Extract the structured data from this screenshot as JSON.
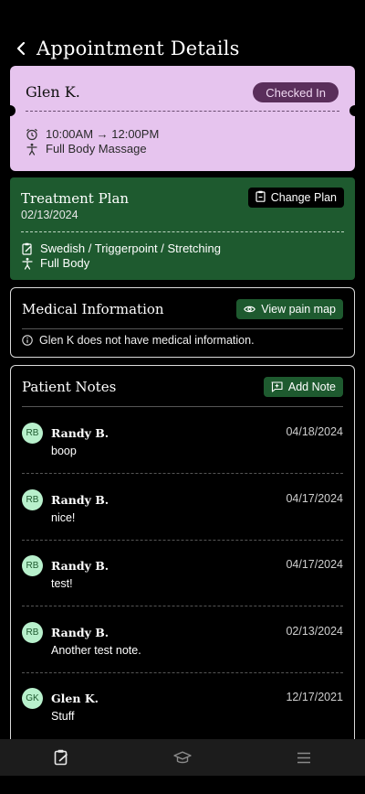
{
  "header": {
    "title": "Appointment Details",
    "back_icon": "chevron-left-icon"
  },
  "appointment": {
    "patient_name": "Glen K.",
    "status": "Checked In",
    "time_range": "10:00AM → 12:00PM",
    "service": "Full Body Massage",
    "bg_color": "#e6c4ee",
    "status_color": "#5a2e5b"
  },
  "treatment_plan": {
    "title": "Treatment Plan",
    "date": "02/13/2024",
    "change_label": "Change Plan",
    "techniques": "Swedish / Triggerpoint / Stretching",
    "area": "Full Body",
    "bg_color": "#1e5a2f"
  },
  "medical": {
    "title": "Medical Information",
    "pain_map_label": "View pain map",
    "info_text": "Glen K does not have medical information."
  },
  "notes": {
    "title": "Patient Notes",
    "add_label": "Add Note",
    "items": [
      {
        "initials": "RB",
        "author": "Randy B.",
        "date": "04/18/2024",
        "text": "boop"
      },
      {
        "initials": "RB",
        "author": "Randy B.",
        "date": "04/17/2024",
        "text": "nice!"
      },
      {
        "initials": "RB",
        "author": "Randy B.",
        "date": "04/17/2024",
        "text": "test!"
      },
      {
        "initials": "RB",
        "author": "Randy B.",
        "date": "02/13/2024",
        "text": "Another test note."
      },
      {
        "initials": "GK",
        "author": "Glen K.",
        "date": "12/17/2021",
        "text": "Stuff"
      }
    ]
  },
  "bottom_nav": {
    "items": [
      {
        "icon": "clipboard-icon"
      },
      {
        "icon": "graduation-cap-icon"
      },
      {
        "icon": "menu-icon"
      }
    ]
  }
}
